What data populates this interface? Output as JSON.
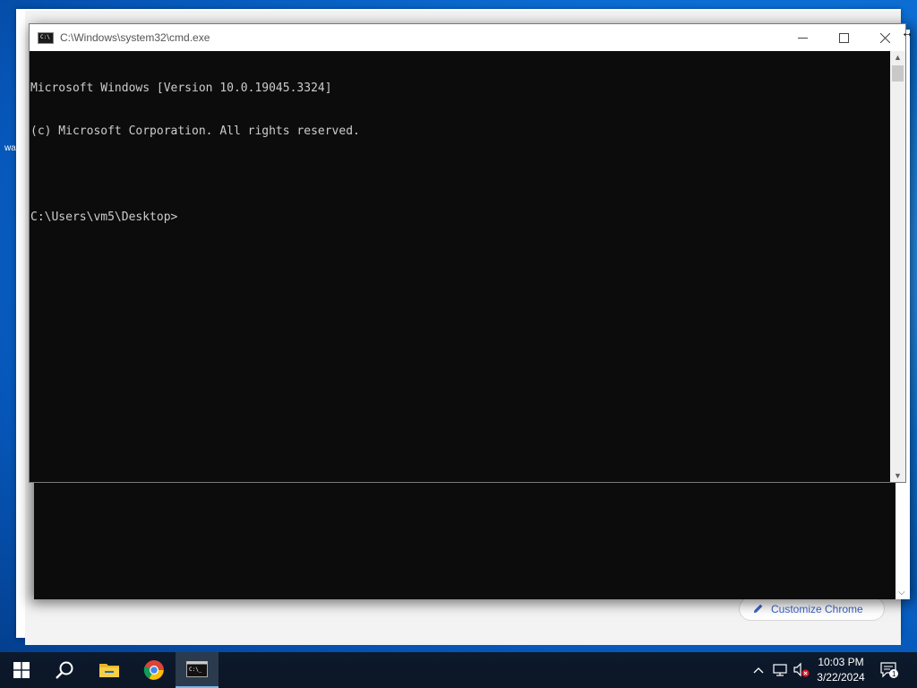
{
  "desktop": {
    "partial_label": "wa"
  },
  "chrome": {
    "customize_label": "Customize Chrome"
  },
  "cmd": {
    "title": "C:\\Windows\\system32\\cmd.exe",
    "icon_text": "C:\\",
    "lines": [
      "Microsoft Windows [Version 10.0.19045.3324]",
      "(c) Microsoft Corporation. All rights reserved.",
      "",
      "C:\\Users\\vm5\\Desktop>"
    ]
  },
  "taskbar": {
    "apps": [
      {
        "name": "start",
        "icon": "windows-logo-icon"
      },
      {
        "name": "search",
        "icon": "search-icon"
      },
      {
        "name": "file-explorer",
        "icon": "folder-icon"
      },
      {
        "name": "chrome",
        "icon": "chrome-icon"
      },
      {
        "name": "command-prompt",
        "icon": "cmd-icon",
        "active": true
      }
    ],
    "time": "10:03 PM",
    "date": "3/22/2024",
    "notification_count": "1"
  }
}
